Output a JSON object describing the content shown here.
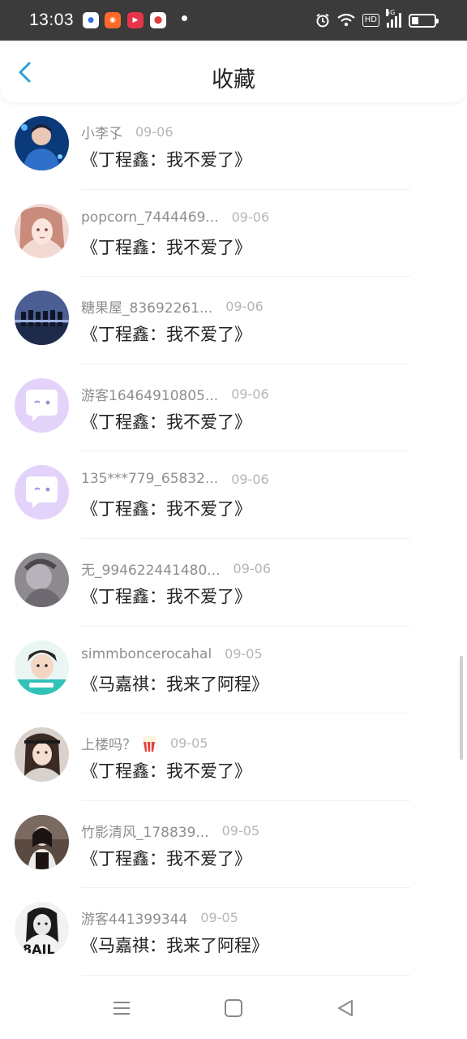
{
  "status_bar": {
    "time": "13:03",
    "apps": [
      "baidu-app-icon",
      "bilibili-app-icon",
      "video-app-icon",
      "map-app-icon"
    ],
    "hd": "HD",
    "network": "5G",
    "battery_level": 0.3
  },
  "header": {
    "title": "收藏"
  },
  "items": [
    {
      "user": "小李孓",
      "date": "09-06",
      "title": "《丁程鑫：我不爱了》",
      "avatar": "photo-blue"
    },
    {
      "user": "popcorn_7444469...",
      "date": "09-06",
      "title": "《丁程鑫：我不爱了》",
      "avatar": "illustration-pink"
    },
    {
      "user": "糖果屋_83692261...",
      "date": "09-06",
      "title": "《丁程鑫：我不爱了》",
      "avatar": "photo-group"
    },
    {
      "user": "游客16464910805...",
      "date": "09-06",
      "title": "《丁程鑫：我不爱了》",
      "avatar": "default-chat"
    },
    {
      "user": "135***779_65832...",
      "date": "09-06",
      "title": "《丁程鑫：我不爱了》",
      "avatar": "default-chat"
    },
    {
      "user": "无_994622441480...",
      "date": "09-06",
      "title": "《丁程鑫：我不爱了》",
      "avatar": "photo-gray"
    },
    {
      "user": "simmboncerocahal",
      "date": "09-05",
      "title": "《马嘉祺：我来了阿程》",
      "avatar": "photo-boy"
    },
    {
      "user": "上楼吗？",
      "date": "09-05",
      "title": "《丁程鑫：我不爱了》",
      "avatar": "photo-girl",
      "emoji": "popcorn-icon"
    },
    {
      "user": "竹影清风_178839...",
      "date": "09-05",
      "title": "《丁程鑫：我不爱了》",
      "avatar": "photo-dark"
    },
    {
      "user": "游客441399344",
      "date": "09-05",
      "title": "《马嘉祺：我来了阿程》",
      "avatar": "photo-bw"
    }
  ],
  "nav": {
    "buttons": [
      "menu-icon",
      "home-icon",
      "back-triangle-icon"
    ]
  },
  "colors": {
    "accent": "#2a9fd8",
    "default_avatar": "#e3d3fb"
  }
}
